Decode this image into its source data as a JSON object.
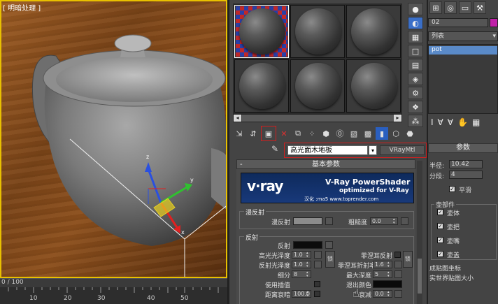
{
  "viewport": {
    "label": "[ 明暗处理 ]"
  },
  "timeline": {
    "counter": "0 / 100",
    "ticks": [
      "10",
      "20",
      "30",
      "40",
      "50"
    ]
  },
  "material_editor": {
    "material_name": "高光面木地板",
    "material_type": "VRayMtl",
    "section_title": "基本参数",
    "banner": {
      "logo": "v·ray",
      "title": "V-Ray PowerShader",
      "subtitle": "optimized for V-Ray",
      "credit": "汉化 :ma5 www.toprender.com"
    },
    "diffuse": {
      "group_title": "漫反射",
      "diffuse_label": "漫反射",
      "roughness_label": "粗糙度",
      "roughness_value": "0.0",
      "diffuse_color": "#8c8c8c"
    },
    "reflection": {
      "group_title": "反射",
      "reflect_label": "反射",
      "reflect_color": "#0c0c0c",
      "hilight_gloss_label": "高光光泽度",
      "hilight_gloss_value": "1.0",
      "lock_label": "锁",
      "fresnel_label": "菲涅耳反射",
      "refl_gloss_label": "反射光泽度",
      "refl_gloss_value": "1.0",
      "fresnel_ior_label": "菲涅耳折射率",
      "fresnel_ior_value": "1.6",
      "subdivs_label": "细分",
      "subdivs_value": "8",
      "max_depth_label": "最大深度",
      "max_depth_value": "5",
      "use_interp_label": "使用插值",
      "exit_color_label": "退出颜色",
      "exit_color": "#0a0a0a",
      "dim_distance_label": "距离衰暗",
      "dim_distance_value": "100.0",
      "dim_falloff_label": "衰减",
      "dim_falloff_value": "0.0",
      "lock_label_2": "锁"
    }
  },
  "command_panel": {
    "object_name": "02",
    "modifier_list": "列表",
    "stack_item": "pot",
    "params_title": "参数",
    "radius_label": "半径:",
    "radius_value": "10.42",
    "segments_label": "分段:",
    "segments_value": "4",
    "smooth_label": "平滑",
    "parts_title": "壶部件",
    "part_body": "壶体",
    "part_handle": "壶把",
    "part_spout": "壶嘴",
    "part_lid": "壶盖",
    "uv_label": "成贴图坐标",
    "real_world_label": "实世界贴图大小"
  }
}
